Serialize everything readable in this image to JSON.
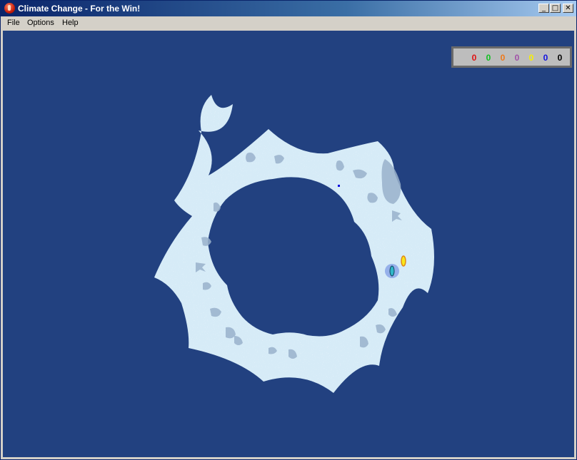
{
  "window": {
    "title": "Climate Change - For the Win!"
  },
  "menu": {
    "file": "File",
    "options": "Options",
    "help": "Help"
  },
  "scores": [
    {
      "player": "red",
      "value": "0",
      "color": "#e01010"
    },
    {
      "player": "green",
      "value": "0",
      "color": "#10c020"
    },
    {
      "player": "orange",
      "value": "0",
      "color": "#f07818"
    },
    {
      "player": "purple",
      "value": "0",
      "color": "#a050a8"
    },
    {
      "player": "yellow",
      "value": "0",
      "color": "#f8f000"
    },
    {
      "player": "blue",
      "value": "0",
      "color": "#1010e0"
    },
    {
      "player": "black",
      "value": "0",
      "color": "#000000"
    }
  ],
  "colors": {
    "ocean": "#224180",
    "ice": "#d6ebf7",
    "rock": "#9ab2cc",
    "titlebar": "#0a246a"
  }
}
